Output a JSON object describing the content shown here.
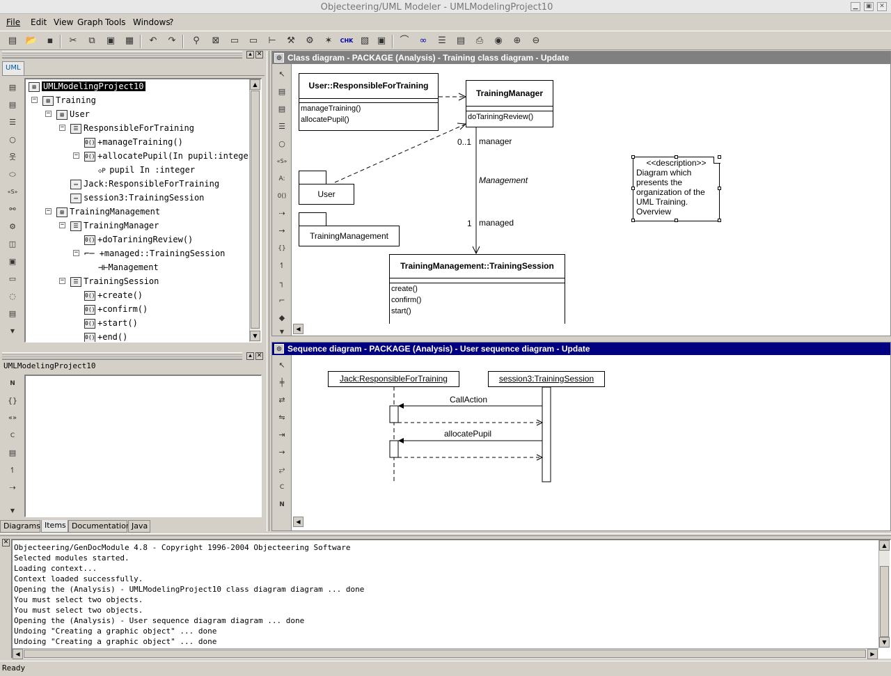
{
  "window": {
    "title": "Objecteering/UML Modeler - UMLModelingProject10"
  },
  "menu": {
    "items": [
      "File",
      "Edit",
      "View",
      "Graph",
      "Tools",
      "Windows",
      "?"
    ]
  },
  "explorer": {
    "tab_label": "UML",
    "tree": [
      {
        "label": "UMLModelingProject10"
      },
      {
        "label": "Training"
      },
      {
        "label": "User"
      },
      {
        "label": "ResponsibleForTraining"
      },
      {
        "label": "+manageTraining()"
      },
      {
        "label": "+allocatePupil(In pupil:integer)"
      },
      {
        "label": "pupil In :integer"
      },
      {
        "label": "Jack:ResponsibleForTraining"
      },
      {
        "label": "session3:TrainingSession"
      },
      {
        "label": "TrainingManagement"
      },
      {
        "label": "TrainingManager"
      },
      {
        "label": "+doTariningReview()"
      },
      {
        "label": "+managed::TrainingSession"
      },
      {
        "label": "Management"
      },
      {
        "label": "TrainingSession"
      },
      {
        "label": "+create()"
      },
      {
        "label": "+confirm()"
      },
      {
        "label": "+start()"
      },
      {
        "label": "+end()"
      }
    ]
  },
  "properties": {
    "title": "UMLModelingProject10"
  },
  "bottom_tabs": [
    "Diagrams",
    "Items",
    "Documentation",
    "Java"
  ],
  "class_diagram": {
    "title": "Class diagram - PACKAGE  (Analysis) - Training class diagram - Update",
    "responsible": {
      "name": "User::ResponsibleForTraining",
      "ops": [
        "manageTraining()",
        "allocatePupil()"
      ]
    },
    "manager": {
      "name": "TrainingManager",
      "ops": [
        "doTariningReview()"
      ]
    },
    "session": {
      "name": "TrainingManagement::TrainingSession",
      "ops": [
        "create()",
        "confirm()",
        "start()"
      ]
    },
    "package_user": "User",
    "package_training": "TrainingManagement",
    "assoc": {
      "name": "Management",
      "mult_top": "0..1",
      "role_top": "manager",
      "mult_bottom": "1",
      "role_bottom": "managed"
    },
    "note": {
      "stereotype": "<<description>>",
      "text": "Diagram which presents the organization of the UML Training. Overview"
    }
  },
  "sequence_diagram": {
    "title": "Sequence diagram - PACKAGE  (Analysis) - User sequence diagram - Update",
    "lifeline1": "Jack:ResponsibleForTraining",
    "lifeline2": "session3:TrainingSession",
    "msg1": "CallAction",
    "msg2": "allocatePupil"
  },
  "console": {
    "lines": [
      "Objecteering/GenDocModule 4.8 - Copyright 1996-2004 Objecteering Software",
      "Selected modules started.",
      "Loading context...",
      "Context loaded successfully.",
      "Opening the (Analysis) - UMLModelingProject10 class diagram diagram ... done",
      "You must select two objects.",
      "You must select two objects.",
      "Opening the (Analysis) - User sequence diagram diagram ... done",
      "Undoing \"Creating a graphic object\" ... done",
      "Undoing \"Creating a graphic object\" ... done"
    ]
  },
  "status": {
    "text": "Ready"
  },
  "colors": {
    "active_title": "#000080",
    "inactive_title": "#808080"
  }
}
